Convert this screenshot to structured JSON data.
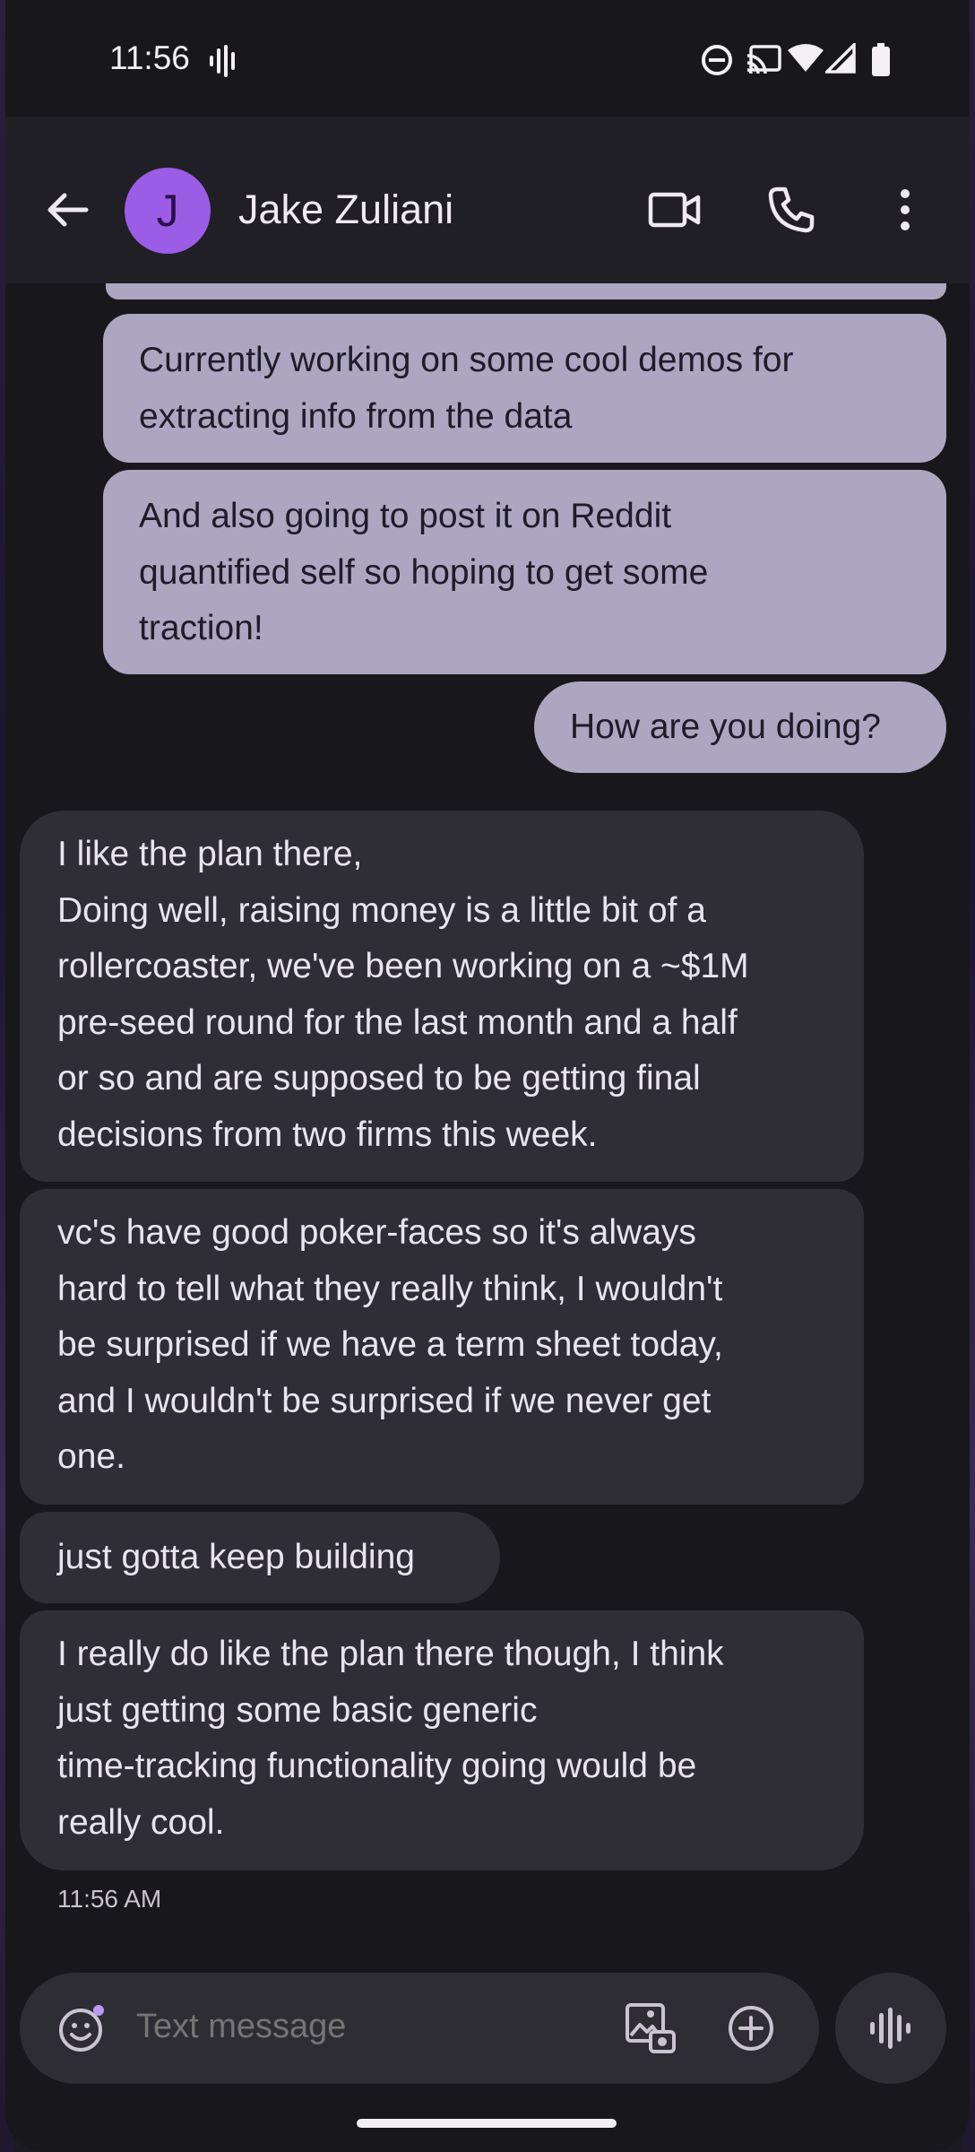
{
  "status_bar": {
    "time": "11:56",
    "icons": [
      "voice-activity-icon",
      "do-not-disturb-icon",
      "cast-icon",
      "wifi-icon",
      "cell-signal-icon",
      "battery-icon"
    ]
  },
  "app_bar": {
    "contact_initial": "J",
    "contact_name": "Jake Zuliani",
    "back_icon": "back-arrow-icon",
    "actions": [
      "video-call-icon",
      "phone-icon",
      "more-options-icon"
    ]
  },
  "messages": [
    {
      "direction": "outgoing",
      "text": "Currently working on some cool demos for\nextracting info from the data"
    },
    {
      "direction": "outgoing",
      "text": "And also going to post it on Reddit\nquantified self so hoping to get some\ntraction!"
    },
    {
      "direction": "outgoing",
      "text": "How are you doing?"
    },
    {
      "direction": "incoming",
      "text": "I like the plan there,\nDoing well, raising money is a little bit of a\nrollercoaster, we've been working on a ~$1M\npre-seed round for the last month and a half\nor so and are supposed to be getting final\ndecisions from two firms this week."
    },
    {
      "direction": "incoming",
      "text": "vc's have good poker-faces so it's always\nhard to tell what they really think, I wouldn't\nbe surprised if we have a term sheet today,\nand I wouldn't be surprised if we never get\none."
    },
    {
      "direction": "incoming",
      "text": "just gotta keep building"
    },
    {
      "direction": "incoming",
      "text": "I really do like the plan there though, I think\njust getting some basic generic\ntime-tracking functionality going would be\nreally cool."
    }
  ],
  "timestamp": "11:56 AM",
  "composer": {
    "placeholder": "Text message",
    "icons": [
      "emoji-icon",
      "gallery-icon",
      "add-icon",
      "voice-message-icon"
    ]
  },
  "colors": {
    "outgoing_bubble": "#aca6c0",
    "incoming_bubble": "#2f2e35",
    "avatar": "#9b5ce6",
    "background": "#18171c"
  }
}
